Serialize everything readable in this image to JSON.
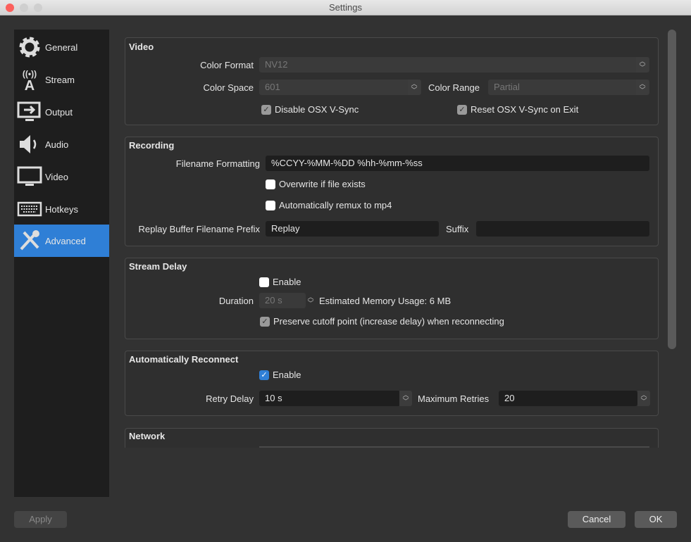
{
  "window": {
    "title": "Settings"
  },
  "sidebar": {
    "items": [
      {
        "label": "General",
        "icon": "gear-icon"
      },
      {
        "label": "Stream",
        "icon": "antenna-icon"
      },
      {
        "label": "Output",
        "icon": "output-monitor-icon"
      },
      {
        "label": "Audio",
        "icon": "speaker-icon"
      },
      {
        "label": "Video",
        "icon": "monitor-icon"
      },
      {
        "label": "Hotkeys",
        "icon": "keyboard-icon"
      },
      {
        "label": "Advanced",
        "icon": "tools-icon",
        "selected": true
      }
    ]
  },
  "video": {
    "title": "Video",
    "color_format_label": "Color Format",
    "color_format": "NV12",
    "color_space_label": "Color Space",
    "color_space": "601",
    "color_range_label": "Color Range",
    "color_range": "Partial",
    "disable_vsync": "Disable OSX V-Sync",
    "reset_vsync": "Reset OSX V-Sync on Exit"
  },
  "recording": {
    "title": "Recording",
    "filename_label": "Filename Formatting",
    "filename": "%CCYY-%MM-%DD %hh-%mm-%ss",
    "overwrite": "Overwrite if file exists",
    "remux": "Automatically remux to mp4",
    "prefix_label": "Replay Buffer Filename Prefix",
    "prefix": "Replay",
    "suffix_label": "Suffix",
    "suffix": ""
  },
  "stream_delay": {
    "title": "Stream Delay",
    "enable": "Enable",
    "duration_label": "Duration",
    "duration": "20 s",
    "memory": "Estimated Memory Usage: 6 MB",
    "preserve": "Preserve cutoff point (increase delay) when reconnecting"
  },
  "reconnect": {
    "title": "Automatically Reconnect",
    "enable": "Enable",
    "retry_label": "Retry Delay",
    "retry": "10 s",
    "max_label": "Maximum Retries",
    "max": "20"
  },
  "network": {
    "title": "Network"
  },
  "buttons": {
    "apply": "Apply",
    "cancel": "Cancel",
    "ok": "OK"
  },
  "colors": {
    "accent": "#2f7fd6",
    "close": "#fc605c"
  }
}
